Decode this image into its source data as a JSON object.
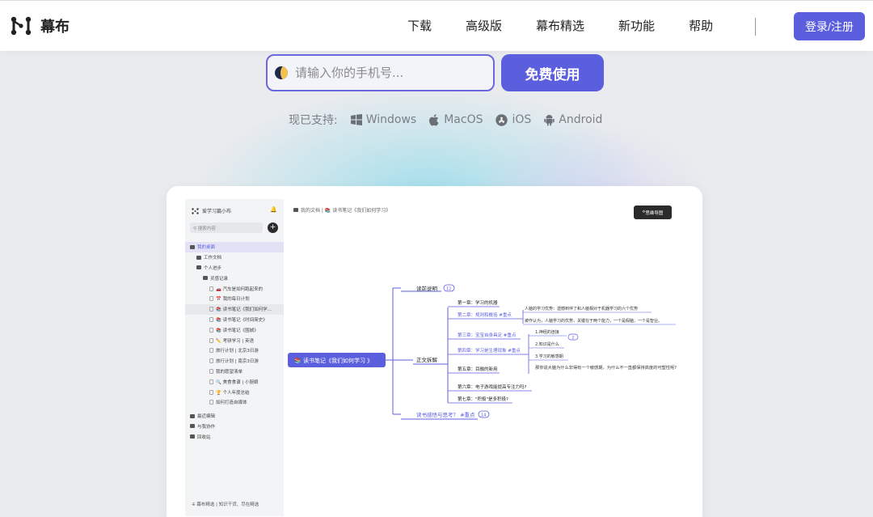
{
  "header": {
    "logo_text": "幕布",
    "nav": [
      "下载",
      "高级版",
      "幕布精选",
      "新功能",
      "帮助"
    ],
    "login_label": "登录/注册"
  },
  "signup": {
    "phone_placeholder": "请输入你的手机号...",
    "free_button": "免费使用",
    "support_label": "现已支持:",
    "platforms": [
      {
        "name": "Windows",
        "icon": "windows-icon"
      },
      {
        "name": "MacOS",
        "icon": "apple-icon"
      },
      {
        "name": "iOS",
        "icon": "app-store-icon"
      },
      {
        "name": "Android",
        "icon": "android-icon"
      }
    ]
  },
  "app": {
    "workspace": "爱学习篇小布",
    "search_placeholder": "搜索内容",
    "sidebar": [
      {
        "label": "我的桌面",
        "level": 0,
        "icon": "home-icon",
        "active": true
      },
      {
        "label": "工作文档",
        "level": 1,
        "icon": "folder-icon"
      },
      {
        "label": "个人进步",
        "level": 1,
        "icon": "folder-icon"
      },
      {
        "label": "灵感记录",
        "level": 2,
        "icon": "folder-icon"
      },
      {
        "label": "🚗 汽车是如何跑起来的",
        "level": 3,
        "icon": "doc-icon"
      },
      {
        "label": "📅 我的每日计划",
        "level": 3,
        "icon": "doc-icon"
      },
      {
        "label": "📚 读书笔记《我们如何学...",
        "level": 3,
        "icon": "doc-icon",
        "highlight": true
      },
      {
        "label": "📚 读书笔记《时间简史》",
        "level": 3,
        "icon": "doc-icon"
      },
      {
        "label": "📚 读书笔记《围城》",
        "level": 3,
        "icon": "doc-icon"
      },
      {
        "label": "✏️ 考研学习 | 英语",
        "level": 3,
        "icon": "doc-icon"
      },
      {
        "label": "旅行计划 | 北京3日游",
        "level": 3,
        "icon": "doc-icon"
      },
      {
        "label": "旅行计划 | 南京3日游",
        "level": 3,
        "icon": "doc-icon"
      },
      {
        "label": "我的愿望清单",
        "level": 3,
        "icon": "doc-icon"
      },
      {
        "label": "🔍 美食食谱 | 小厨娘",
        "level": 3,
        "icon": "doc-icon"
      },
      {
        "label": "🏆 个人年度总结",
        "level": 3,
        "icon": "doc-icon"
      },
      {
        "label": "如何打造自媒体",
        "level": 3,
        "icon": "doc-icon"
      },
      {
        "label": "最近编辑",
        "level": 0,
        "icon": "clock-icon"
      },
      {
        "label": "与我协作",
        "level": 0,
        "icon": "people-icon"
      },
      {
        "label": "回收站",
        "level": 0,
        "icon": "trash-icon"
      }
    ],
    "footer": "幕布精选 | 知识干货、尽在精选",
    "breadcrumb": "我的文档 | 📚 读书笔记《我们如何学习》",
    "view_button": "思维导图",
    "mindmap": {
      "root": "📚 读书笔记《我们如何学习 》",
      "branches": [
        {
          "label": "读前说明",
          "badge": "12"
        },
        {
          "label": "正文拆解"
        },
        {
          "label": "读书感悟与思考？ #重点",
          "badge": "14"
        }
      ],
      "chapters": [
        "第一章：学习的机器",
        "第二章：规则和概括 #重点",
        "第三章：宝宝自身具足 #重点",
        "第四章：学习是生理现象 #重点",
        "第五章：目融的新用",
        "第六章：电子游戏能提高专注力吗?",
        "第七章：\"积极\"是多积极?"
      ],
      "notes": [
        "人脑的学习优势：遗憾到伴了和人脑相对于机器学习的六个优势",
        "被作认为，人脑学习的优势，关键在于两个能力，一个是假脑，一个是智业。",
        "1.神经的连接",
        "2.知识是什么",
        "3.学习的敏感期",
        "那你说大脑为什么非得有一个敏感期，为什么不一直都保持高度的可塑性呢?"
      ],
      "note_badge": "2"
    }
  }
}
